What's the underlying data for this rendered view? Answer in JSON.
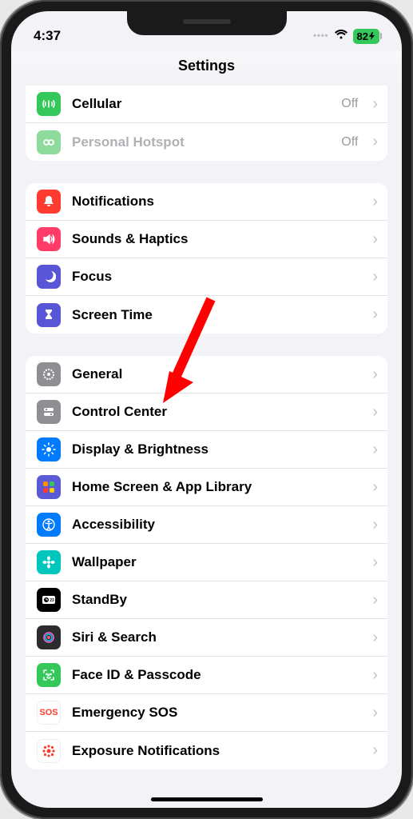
{
  "status": {
    "time": "4:37",
    "battery": "82"
  },
  "header": {
    "title": "Settings"
  },
  "groups": [
    {
      "id": "network",
      "rows": [
        {
          "id": "cellular",
          "label": "Cellular",
          "value": "Off",
          "iconBg": "#34c759",
          "disabled": false
        },
        {
          "id": "hotspot",
          "label": "Personal Hotspot",
          "value": "Off",
          "iconBg": "#8fdb9e",
          "disabled": true
        }
      ]
    },
    {
      "id": "alerts",
      "rows": [
        {
          "id": "notifications",
          "label": "Notifications",
          "iconBg": "#ff3b30"
        },
        {
          "id": "sounds",
          "label": "Sounds & Haptics",
          "iconBg": "#ff3b67"
        },
        {
          "id": "focus",
          "label": "Focus",
          "iconBg": "#5856d6"
        },
        {
          "id": "screentime",
          "label": "Screen Time",
          "iconBg": "#5856d6"
        }
      ]
    },
    {
      "id": "system",
      "rows": [
        {
          "id": "general",
          "label": "General",
          "iconBg": "#8e8e93"
        },
        {
          "id": "controlcenter",
          "label": "Control Center",
          "iconBg": "#8e8e93"
        },
        {
          "id": "display",
          "label": "Display & Brightness",
          "iconBg": "#007aff"
        },
        {
          "id": "homescreen",
          "label": "Home Screen & App Library",
          "iconBg": "#5b5ad6"
        },
        {
          "id": "accessibility",
          "label": "Accessibility",
          "iconBg": "#007aff"
        },
        {
          "id": "wallpaper",
          "label": "Wallpaper",
          "iconBg": "#00c7be"
        },
        {
          "id": "standby",
          "label": "StandBy",
          "iconBg": "#000000"
        },
        {
          "id": "siri",
          "label": "Siri & Search",
          "iconBg": "#2c2c2e"
        },
        {
          "id": "faceid",
          "label": "Face ID & Passcode",
          "iconBg": "#34c759"
        },
        {
          "id": "sos",
          "label": "Emergency SOS",
          "iconBg": "#ffffff",
          "iconText": "SOS",
          "iconColor": "#ff3b30"
        },
        {
          "id": "exposure",
          "label": "Exposure Notifications",
          "iconBg": "#ffffff",
          "iconColor": "#ff3b30"
        }
      ]
    }
  ],
  "annotation": {
    "target": "general"
  }
}
